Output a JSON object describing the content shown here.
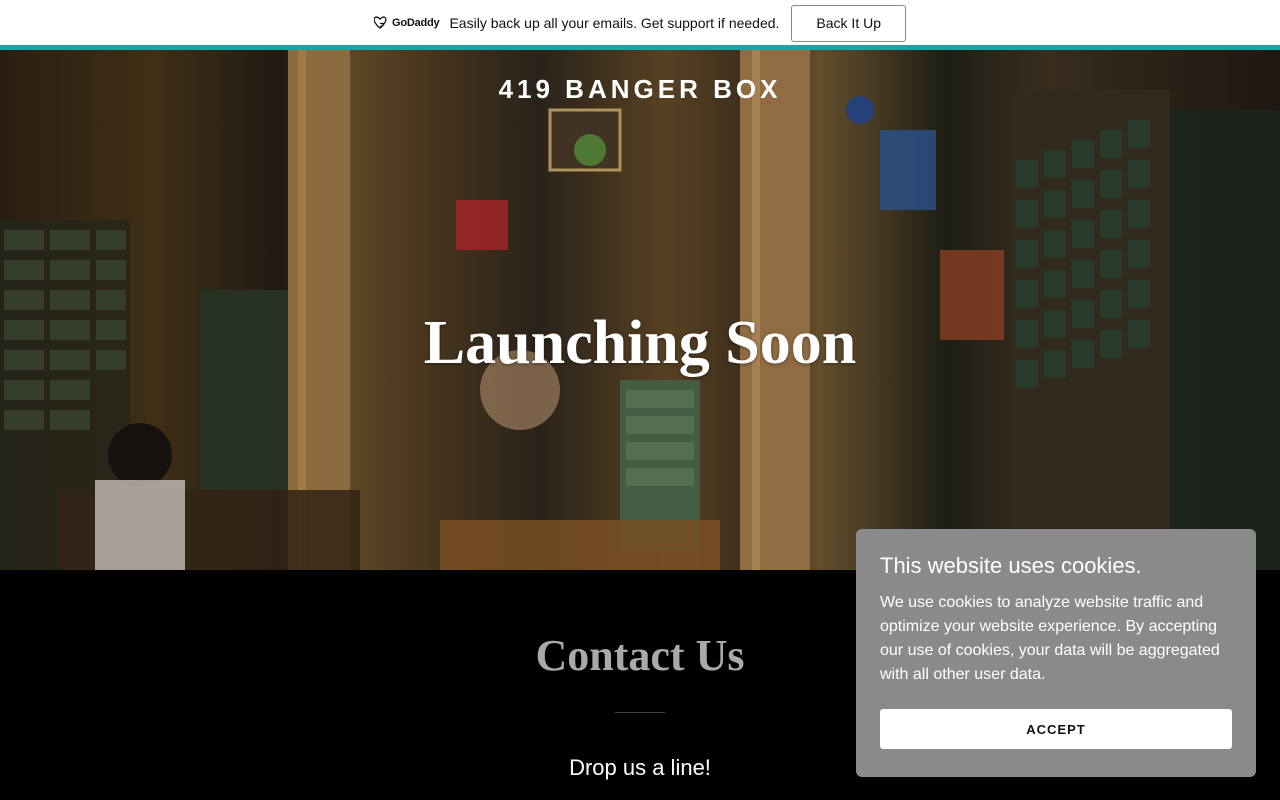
{
  "promo": {
    "brand": "GoDaddy",
    "message": "Easily back up all your emails. Get support if needed.",
    "button_label": "Back It Up",
    "accent_color": "#1ba5a5"
  },
  "hero": {
    "brand_title": "419 BANGER BOX",
    "headline": "Launching Soon"
  },
  "contact": {
    "title": "Contact Us",
    "subtitle": "Drop us a line!"
  },
  "cookie": {
    "title": "This website uses cookies.",
    "body": "We use cookies to analyze website traffic and optimize your website experience. By accepting our use of cookies, your data will be aggregated with all other user data.",
    "accept_label": "ACCEPT"
  }
}
